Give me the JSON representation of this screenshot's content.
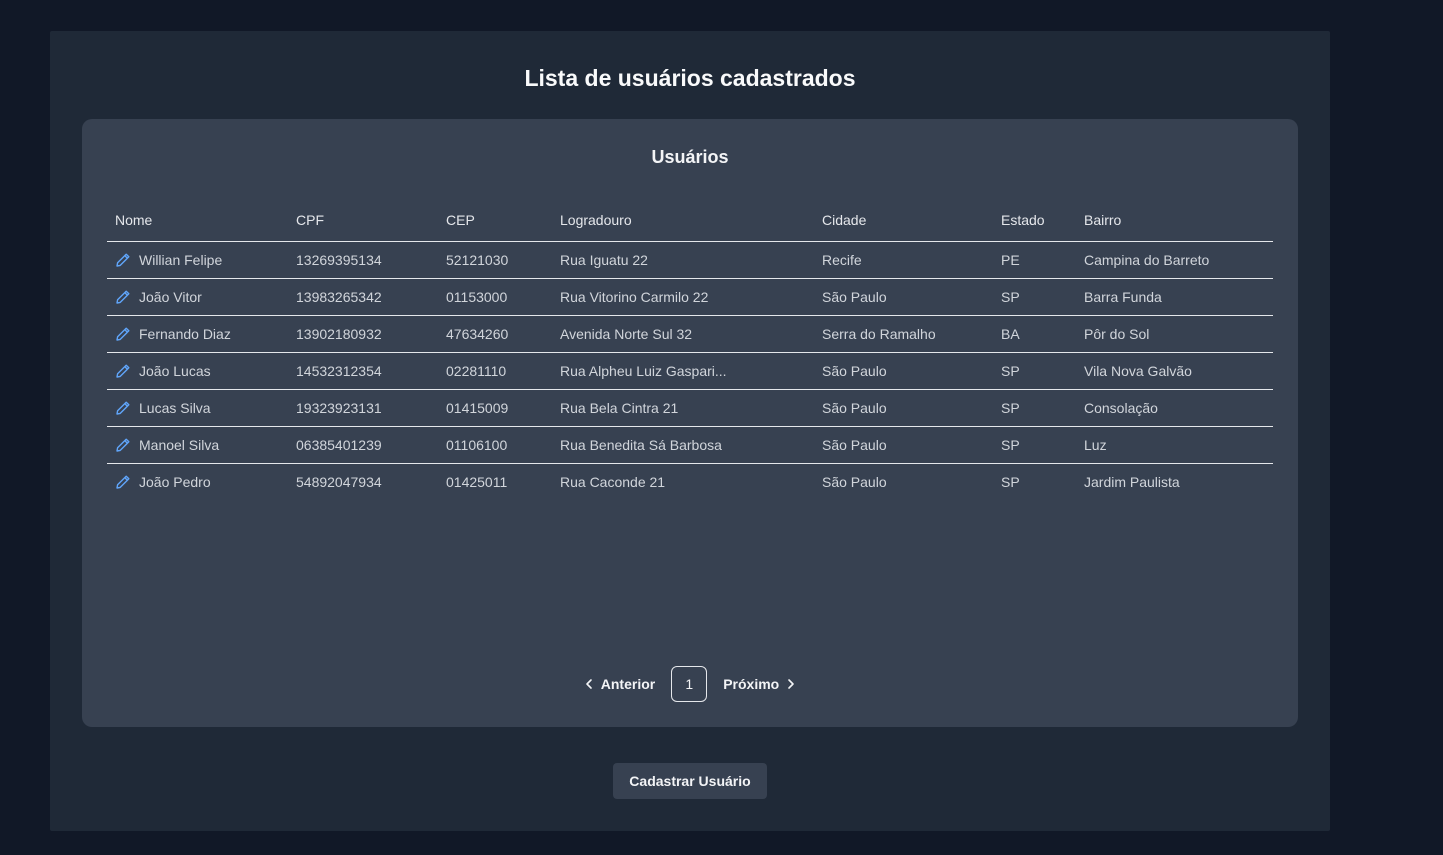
{
  "page": {
    "title": "Lista de usuários cadastrados"
  },
  "card": {
    "title": "Usuários"
  },
  "table": {
    "headers": [
      "Nome",
      "CPF",
      "CEP",
      "Logradouro",
      "Cidade",
      "Estado",
      "Bairro"
    ],
    "rows": [
      {
        "nome": "Willian Felipe",
        "cpf": "13269395134",
        "cep": "52121030",
        "logradouro": "Rua Iguatu 22",
        "cidade": "Recife",
        "estado": "PE",
        "bairro": "Campina do Barreto"
      },
      {
        "nome": "João Vitor",
        "cpf": "13983265342",
        "cep": "01153000",
        "logradouro": "Rua Vitorino Carmilo 22",
        "cidade": "São Paulo",
        "estado": "SP",
        "bairro": "Barra Funda"
      },
      {
        "nome": "Fernando Diaz",
        "cpf": "13902180932",
        "cep": "47634260",
        "logradouro": "Avenida Norte Sul 32",
        "cidade": "Serra do Ramalho",
        "estado": "BA",
        "bairro": "Pôr do Sol"
      },
      {
        "nome": "João Lucas",
        "cpf": "14532312354",
        "cep": "02281110",
        "logradouro": "Rua Alpheu Luiz Gaspari...",
        "cidade": "São Paulo",
        "estado": "SP",
        "bairro": "Vila Nova Galvão"
      },
      {
        "nome": "Lucas Silva",
        "cpf": "19323923131",
        "cep": "01415009",
        "logradouro": "Rua Bela Cintra 21",
        "cidade": "São Paulo",
        "estado": "SP",
        "bairro": "Consolação"
      },
      {
        "nome": "Manoel Silva",
        "cpf": "06385401239",
        "cep": "01106100",
        "logradouro": "Rua Benedita Sá Barbosa",
        "cidade": "São Paulo",
        "estado": "SP",
        "bairro": "Luz"
      },
      {
        "nome": "João Pedro",
        "cpf": "54892047934",
        "cep": "01425011",
        "logradouro": "Rua Caconde 21",
        "cidade": "São Paulo",
        "estado": "SP",
        "bairro": "Jardim Paulista"
      }
    ],
    "edit_icon": "pencil-icon"
  },
  "pagination": {
    "prev_label": "Anterior",
    "current_page": "1",
    "next_label": "Próximo"
  },
  "actions": {
    "register_label": "Cadastrar Usuário"
  },
  "colors": {
    "background": "#111827",
    "panel": "#1f2937",
    "card": "#374151",
    "accent": "#60a5fa"
  }
}
